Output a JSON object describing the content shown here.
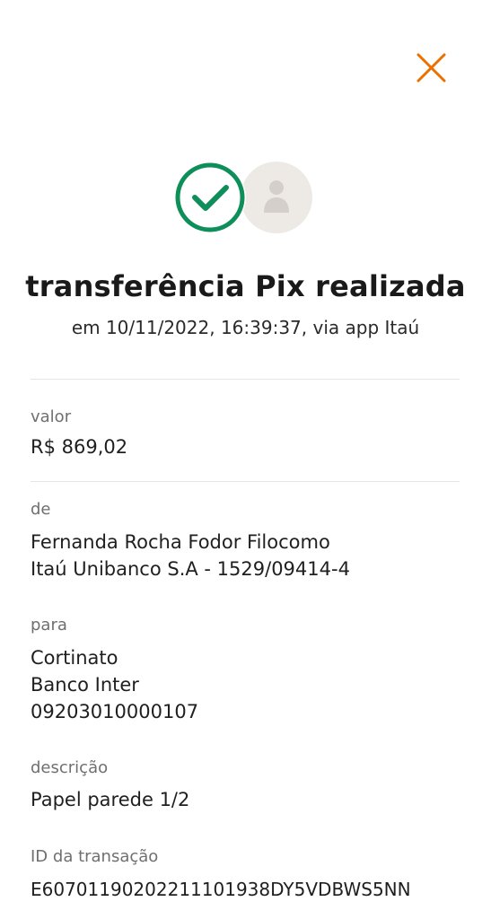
{
  "colors": {
    "accent": "#EC7000",
    "success": "#0E8F5A",
    "avatar_bg": "#EDEAE6",
    "avatar_fg": "#D4CFCA"
  },
  "header": {
    "close_icon": "close-icon"
  },
  "status": {
    "check_icon": "check-circle-icon",
    "avatar_icon": "person-icon"
  },
  "receipt": {
    "title": "transferência Pix realizada",
    "subtitle": "em 10/11/2022, 16:39:37, via app Itaú",
    "valor": {
      "label": "valor",
      "value": "R$ 869,02"
    },
    "de": {
      "label": "de",
      "name": "Fernanda Rocha Fodor Filocomo",
      "bank": "Itaú Unibanco S.A - 1529/09414-4"
    },
    "para": {
      "label": "para",
      "name": "Cortinato",
      "bank": "Banco Inter",
      "document": "09203010000107"
    },
    "descricao": {
      "label": "descrição",
      "value": "Papel parede 1/2"
    },
    "id_transacao": {
      "label": "ID da transação",
      "value": "E60701190202211101938DY5VDBWS5NN"
    }
  }
}
